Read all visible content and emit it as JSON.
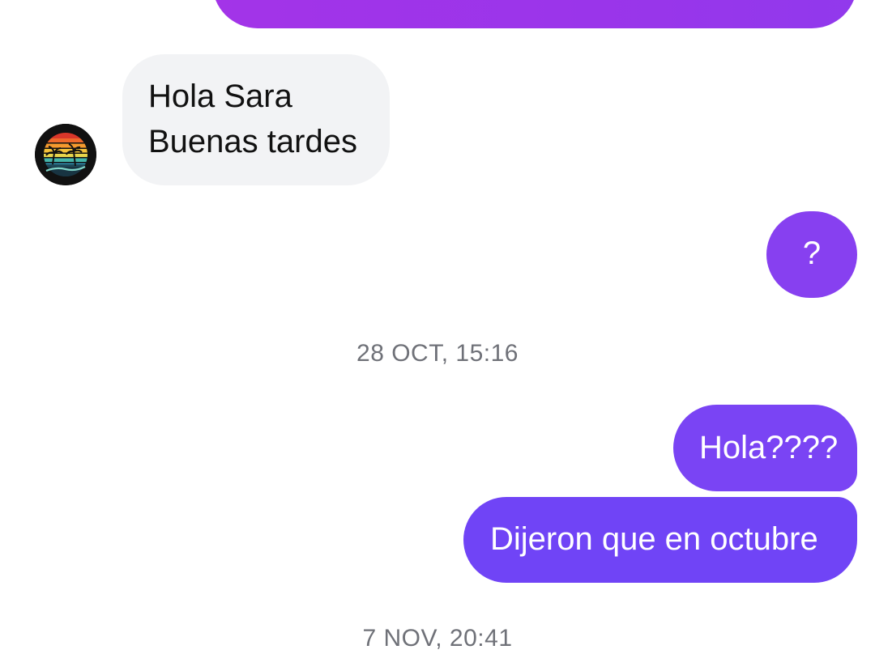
{
  "conversation": {
    "messages": [
      {
        "direction": "outgoing",
        "text": ""
      },
      {
        "direction": "incoming",
        "lines": [
          "Hola Sara",
          "Buenas tardes"
        ]
      },
      {
        "direction": "outgoing",
        "text": "?"
      }
    ],
    "timestamps": [
      "28 OCT, 15:16",
      "7 NOV, 20:41"
    ],
    "after_first_timestamp": [
      {
        "direction": "outgoing",
        "text": "Hola????"
      },
      {
        "direction": "outgoing",
        "text": "Dijeron que en octubre"
      }
    ]
  },
  "contact": {
    "avatar_icon": "sunset-palm-trees-logo"
  },
  "colors": {
    "incoming_bubble": "#f2f3f5",
    "outgoing_gradient_top": "#9a35ea",
    "outgoing_gradient_mid": "#8740f0",
    "outgoing_gradient_bottom": "#7044f6",
    "timestamp_text": "#6f7178"
  }
}
